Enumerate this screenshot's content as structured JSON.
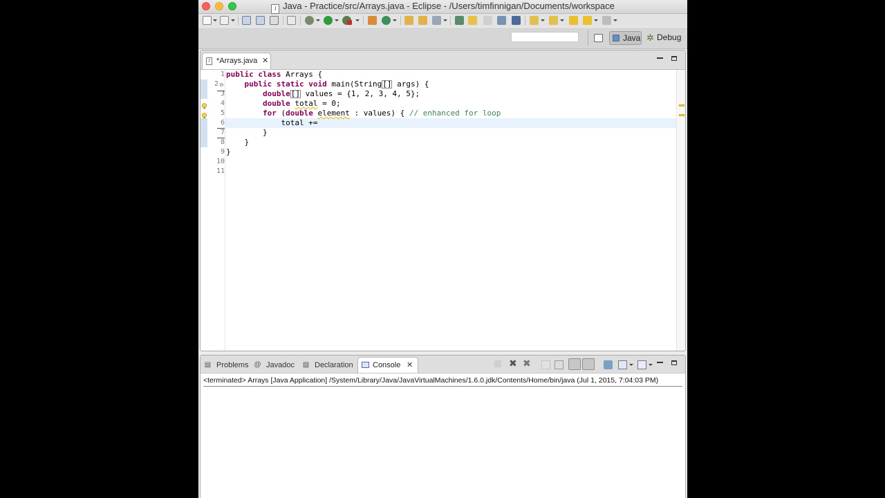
{
  "window": {
    "title": "Java - Practice/src/Arrays.java - Eclipse - /Users/timfinnigan/Documents/workspace"
  },
  "colors": {
    "keyword": "#7f0055",
    "comment": "#3f7f5f",
    "current_line": "#e8f2fe",
    "warning": "#d8b400"
  },
  "toolbar": {
    "quick_access_placeholder": "",
    "perspectives": [
      {
        "label": "Java",
        "icon": "java-perspective-icon",
        "active": true
      },
      {
        "label": "Debug",
        "icon": "debug-bug-icon",
        "active": false
      }
    ]
  },
  "editor": {
    "tab_label": "*Arrays.java",
    "line_numbers": [
      "1",
      "2",
      "3",
      "4",
      "5",
      "6",
      "7",
      "8",
      "9",
      "10",
      "11"
    ],
    "lines": {
      "l1_kw": "public class ",
      "l1_rest": "Arrays {",
      "l2_indent": "    ",
      "l2_kw": "public static void ",
      "l2_a": "main(String",
      "l2_br": "[]",
      "l2_b": " args) {",
      "l3_indent": "        ",
      "l3_kw": "double",
      "l3_br": "[]",
      "l3_rest": " values = {1, 2, 3, 4, 5};",
      "l4_indent": "        ",
      "l4_kw": "double ",
      "l4_var": "total",
      "l4_rest": " = 0;",
      "l5_indent": "        ",
      "l5_kw1": "for",
      "l5_a": " (",
      "l5_kw2": "double ",
      "l5_var": "element",
      "l5_b": " : values) { ",
      "l5_comment": "// enhanced for loop",
      "l6_indent": "            ",
      "l6_text": "total +=",
      "l7_indent": "        ",
      "l7_text": "}",
      "l8_indent": "    ",
      "l8_text": "}",
      "l9_text": "}"
    }
  },
  "console": {
    "tabs": [
      {
        "label": "Problems",
        "icon": "problems-icon"
      },
      {
        "label": "Javadoc",
        "icon": "at-sign-icon"
      },
      {
        "label": "Declaration",
        "icon": "declaration-icon"
      }
    ],
    "active_tab_label": "Console",
    "header": "<terminated> Arrays [Java Application] /System/Library/Java/JavaVirtualMachines/1.6.0.jdk/Contents/Home/bin/java (Jul 1, 2015, 7:04:03 PM)"
  }
}
